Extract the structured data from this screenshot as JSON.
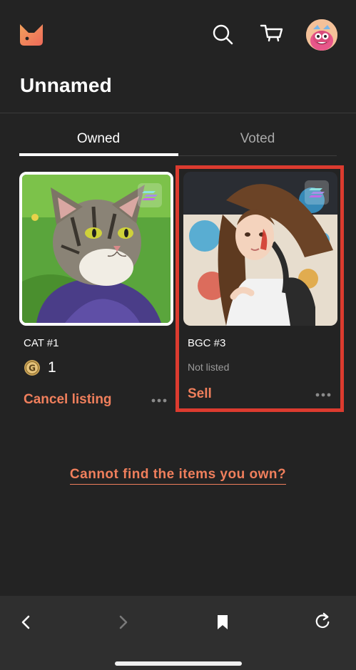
{
  "header": {
    "logo_icon": "fox-logo-icon",
    "search_icon": "search-icon",
    "cart_icon": "cart-icon",
    "avatar_icon": "avatar"
  },
  "page_title": "Unnamed",
  "tabs": [
    {
      "label": "Owned",
      "active": true
    },
    {
      "label": "Voted",
      "active": false
    }
  ],
  "cards": [
    {
      "name": "CAT #1",
      "price": "1",
      "action_label": "Cancel listing",
      "status": ""
    },
    {
      "name": "BGC #3",
      "price": "",
      "status": "Not listed",
      "action_label": "Sell"
    }
  ],
  "help_link": "Cannot find the items you own?",
  "colors": {
    "background": "#232323",
    "accent": "#f07f5c",
    "highlight": "#dc3b2f",
    "muted_text": "#9b9b9b",
    "bottom_bar": "#2f2f2f"
  }
}
